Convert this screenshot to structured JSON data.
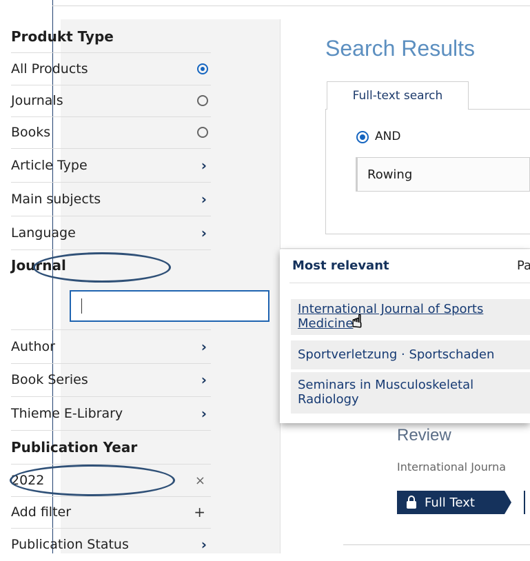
{
  "sidebar": {
    "product_type": {
      "heading": "Produkt Type",
      "options": [
        {
          "label": "All Products",
          "selected": true
        },
        {
          "label": "Journals",
          "selected": false
        },
        {
          "label": "Books",
          "selected": false
        }
      ]
    },
    "facets_a": [
      {
        "label": "Article Type"
      },
      {
        "label": "Main subjects"
      },
      {
        "label": "Language"
      }
    ],
    "journal": {
      "heading": "Journal",
      "input_value": ""
    },
    "facets_b": [
      {
        "label": "Author"
      },
      {
        "label": "Book Series"
      },
      {
        "label": "Thieme E-Library"
      }
    ],
    "publication_year": {
      "heading": "Publication Year",
      "value": "2022"
    },
    "add_filter": "Add filter",
    "publication_status": "Publication Status"
  },
  "main": {
    "title": "Search Results",
    "tab": "Full-text search",
    "operator": "AND",
    "query": "Rowing",
    "result": {
      "type": "Review",
      "journal_ref": "International Journa",
      "fulltext_label": "Full Text"
    }
  },
  "dropdown": {
    "header": "Most relevant",
    "header2": "Pa",
    "items": [
      {
        "label": "International Journal of Sports Medicine",
        "line1": "International Journal of Sports",
        "line2": "Medicine"
      },
      {
        "label": "Sportverletzung · Sportschaden"
      },
      {
        "label": "Seminars in Musculoskeletal Radiology",
        "line1": "Seminars in Musculoskeletal",
        "line2": "Radiology"
      }
    ]
  },
  "colors": {
    "accent": "#1565c0",
    "navy": "#15325c",
    "annotation": "#2f5077"
  }
}
